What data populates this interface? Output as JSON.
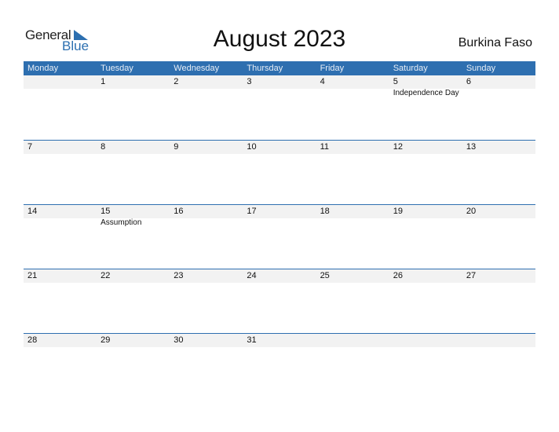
{
  "logo": {
    "general": "General",
    "blue": "Blue"
  },
  "title": "August 2023",
  "country": "Burkina Faso",
  "colors": {
    "accent": "#2e6fb0",
    "strip": "#f2f2f2"
  },
  "weekdays": [
    "Monday",
    "Tuesday",
    "Wednesday",
    "Thursday",
    "Friday",
    "Saturday",
    "Sunday"
  ],
  "weeks": [
    {
      "days": [
        "",
        "1",
        "2",
        "3",
        "4",
        "5",
        "6"
      ],
      "holidays": [
        "",
        "",
        "",
        "",
        "",
        "Independence Day",
        ""
      ]
    },
    {
      "days": [
        "7",
        "8",
        "9",
        "10",
        "11",
        "12",
        "13"
      ],
      "holidays": [
        "",
        "",
        "",
        "",
        "",
        "",
        ""
      ]
    },
    {
      "days": [
        "14",
        "15",
        "16",
        "17",
        "18",
        "19",
        "20"
      ],
      "holidays": [
        "",
        "Assumption",
        "",
        "",
        "",
        "",
        ""
      ]
    },
    {
      "days": [
        "21",
        "22",
        "23",
        "24",
        "25",
        "26",
        "27"
      ],
      "holidays": [
        "",
        "",
        "",
        "",
        "",
        "",
        ""
      ]
    },
    {
      "days": [
        "28",
        "29",
        "30",
        "31",
        "",
        "",
        ""
      ],
      "holidays": [
        "",
        "",
        "",
        "",
        "",
        "",
        ""
      ]
    }
  ]
}
